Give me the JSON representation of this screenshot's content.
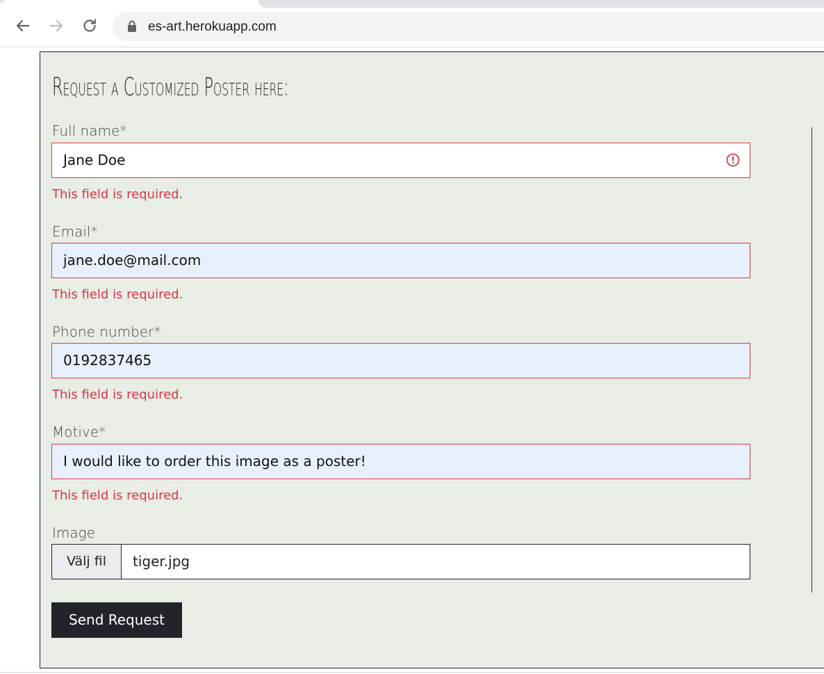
{
  "browser": {
    "url": "es-art.herokuapp.com"
  },
  "form": {
    "title": "Request a Customized Poster here:",
    "fields": [
      {
        "label": "Full name*",
        "value": "Jane Doe",
        "error": "This field is required."
      },
      {
        "label": "Email*",
        "value": "jane.doe@mail.com",
        "error": "This field is required."
      },
      {
        "label": "Phone number*",
        "value": "0192837465",
        "error": "This field is required."
      },
      {
        "label": "Motive*",
        "value": "I would like to order this image as a poster!",
        "error": "This field is required."
      }
    ],
    "image": {
      "label": "Image",
      "button_label": "Välj fil",
      "file_name": "tiger.jpg"
    },
    "submit_label": "Send Request"
  },
  "colors": {
    "error": "#dc3545",
    "panel_bg": "#e8ede6",
    "button_bg": "#212529",
    "autofill_bg": "#e8f0fe"
  },
  "icons": {
    "back": "arrow-left-icon",
    "forward": "arrow-right-icon",
    "reload": "reload-icon",
    "secure": "lock-icon",
    "invalid": "exclamation-circle-icon"
  }
}
